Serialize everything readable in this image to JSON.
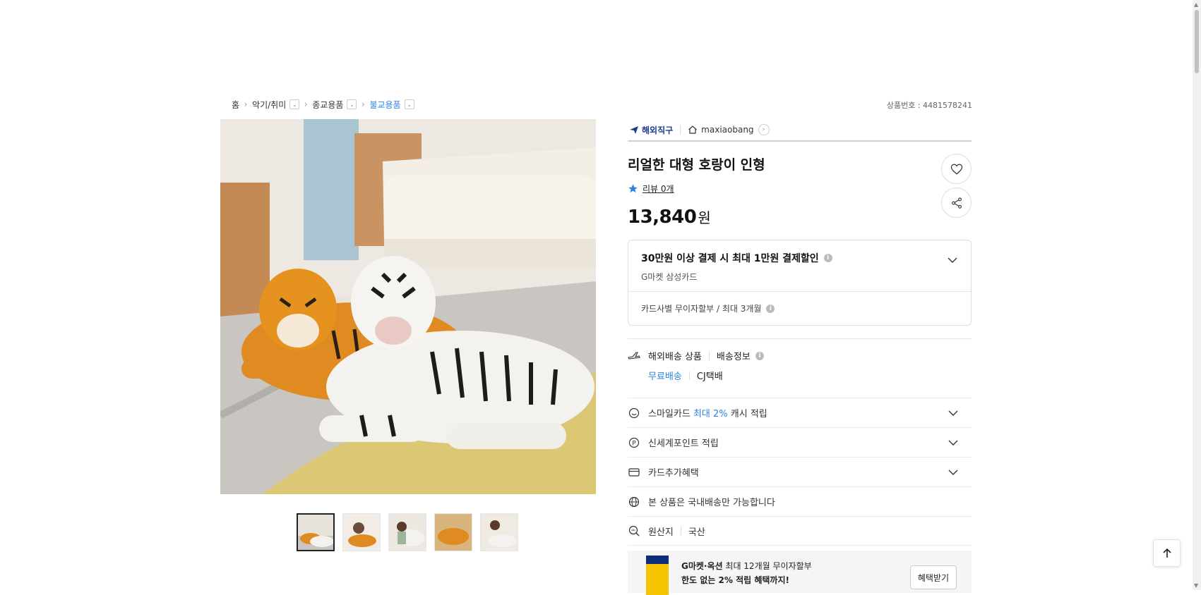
{
  "breadcrumb": {
    "home": "홈",
    "level1": "악기/취미",
    "level2": "종교용품",
    "level3": "불교용품"
  },
  "product_no": "상품번호 : 4481578241",
  "seller": {
    "badge": "해외직구",
    "shop_name": "maxiaobang"
  },
  "product": {
    "title": "리얼한 대형 호랑이 인형",
    "review": "리뷰 0개",
    "price": "13,840",
    "currency": "원"
  },
  "benefit": {
    "title": "30만원 이상 결제 시 최대 1만원 결제할인",
    "card": "G마켓 삼성카드",
    "installment": "카드사별 무이자할부 / 최대 3개월"
  },
  "shipping": {
    "type": "해외배송 상품",
    "info": "배송정보",
    "free": "무료배송",
    "carrier": "CJ택배"
  },
  "rows": {
    "smile_prefix": "스마일카드",
    "smile_highlight": "최대 2%",
    "smile_suffix": "캐시 적립",
    "points": "신세계포인트 적립",
    "card_extra": "카드추가혜택",
    "domestic": "본 상품은 국내배송만 가능합니다",
    "origin_label": "원산지",
    "origin_value": "국산"
  },
  "card_banner": {
    "line1_bold": "G마켓·옥션",
    "line1_rest": "최대 12개월 무이자할부",
    "line2": "한도 없는 2% 적립 혜택까지!",
    "button": "혜택받기"
  },
  "colors": {
    "accent_blue": "#2a82e4",
    "overseas_navy": "#1a3c8f"
  }
}
